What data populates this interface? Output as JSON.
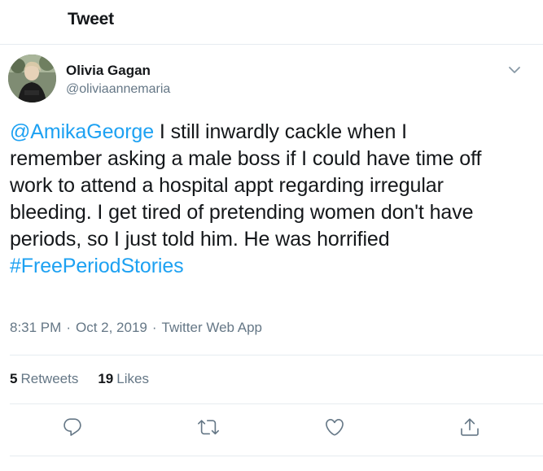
{
  "header": {
    "title": "Tweet"
  },
  "author": {
    "name": "Olivia Gagan",
    "handle": "@oliviaannemaria",
    "avatar_icon": "profile-photo"
  },
  "tweet": {
    "mention": "@AmikaGeorge",
    "line1_rest": " I still inwardly cackle when I",
    "line2": "remember asking a male boss if I could have time off",
    "line3": "work to attend a hospital appt regarding irregular",
    "line4": "bleeding. I get tired of pretending women don't have",
    "line5": "periods, so I just told him. He was horrified",
    "hashtag": "#FreePeriodStories"
  },
  "meta": {
    "time": "8:31 PM",
    "separator": "·",
    "date": "Oct 2, 2019",
    "source": "Twitter Web App"
  },
  "stats": {
    "retweets_count": "5",
    "retweets_label": "Retweets",
    "likes_count": "19",
    "likes_label": "Likes"
  },
  "actions": {
    "reply_icon": "reply-icon",
    "retweet_icon": "retweet-icon",
    "like_icon": "heart-icon",
    "share_icon": "share-icon"
  },
  "colors": {
    "link": "#1da1f2",
    "muted": "#657786",
    "text": "#14171a",
    "divider": "#e6ecf0"
  }
}
